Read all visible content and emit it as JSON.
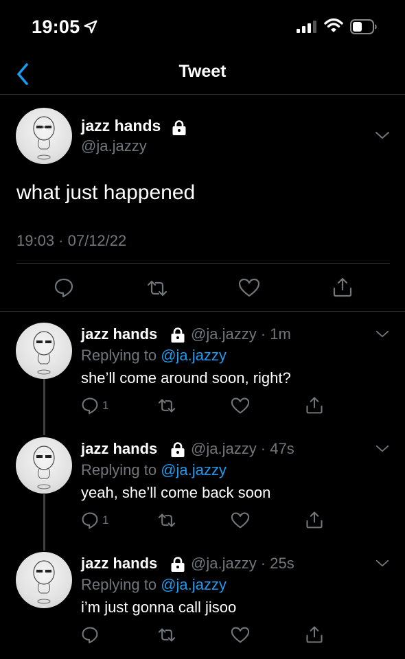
{
  "status_bar": {
    "time": "19:05"
  },
  "nav": {
    "title": "Tweet"
  },
  "main_tweet": {
    "name": "jazz hands",
    "handle": "@ja.jazzy",
    "text": "what just happened",
    "meta": "19:03 · 07/12/22"
  },
  "replies": [
    {
      "name": "jazz hands",
      "handle_time": "@ja.jazzy · 1m",
      "replying_prefix": "Replying to",
      "replying_to": "@ja.jazzy",
      "text": "she’ll come around soon, right?",
      "reply_count": "1"
    },
    {
      "name": "jazz hands",
      "handle_time": "@ja.jazzy · 47s",
      "replying_prefix": "Replying to",
      "replying_to": "@ja.jazzy",
      "text": "yeah, she’ll come back soon",
      "reply_count": "1"
    },
    {
      "name": "jazz hands",
      "handle_time": "@ja.jazzy · 25s",
      "replying_prefix": "Replying to",
      "replying_to": "@ja.jazzy",
      "text": "i’m just gonna call jisoo",
      "reply_count": ""
    }
  ],
  "colors": {
    "background": "#000000",
    "accent": "#1d9bf0",
    "secondary_text": "#71767b",
    "divider": "#2f3336"
  },
  "icons": [
    "location-arrow-icon",
    "signal-icon",
    "wifi-icon",
    "battery-icon",
    "back-chevron-icon",
    "lock-icon",
    "chevron-down-icon",
    "reply-icon",
    "retweet-icon",
    "like-icon",
    "share-icon"
  ]
}
